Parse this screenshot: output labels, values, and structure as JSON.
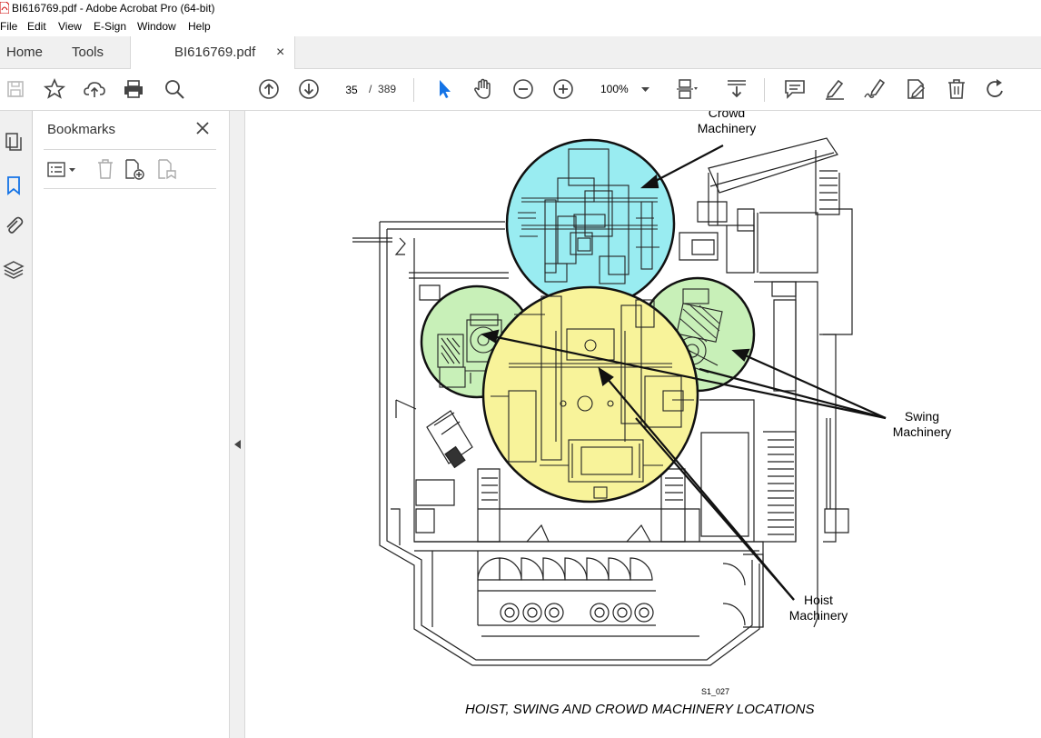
{
  "window": {
    "title": "BI616769.pdf - Adobe Acrobat Pro (64-bit)"
  },
  "menu": [
    "File",
    "Edit",
    "View",
    "E-Sign",
    "Window",
    "Help"
  ],
  "tabs": {
    "home": "Home",
    "tools": "Tools",
    "document": "BI616769.pdf",
    "close": "×"
  },
  "toolbar": {
    "current_page": "35",
    "page_separator": "/",
    "page_count": "389",
    "zoom": "100%"
  },
  "sidebar": {
    "title": "Bookmarks",
    "close": "×"
  },
  "colors": {
    "crowd": "#99ecf1",
    "swing": "#c8f0b8",
    "hoist": "#f8f39a",
    "accent": "#1473e6"
  },
  "document": {
    "labels": {
      "crowd_line1": "Crowd",
      "crowd_line2": "Machinery",
      "swing_line1": "Swing",
      "swing_line2": "Machinery",
      "hoist_line1": "Hoist",
      "hoist_line2": "Machinery"
    },
    "figure_id": "S1_027",
    "caption": "HOIST, SWING AND CROWD MACHINERY LOCATIONS"
  }
}
